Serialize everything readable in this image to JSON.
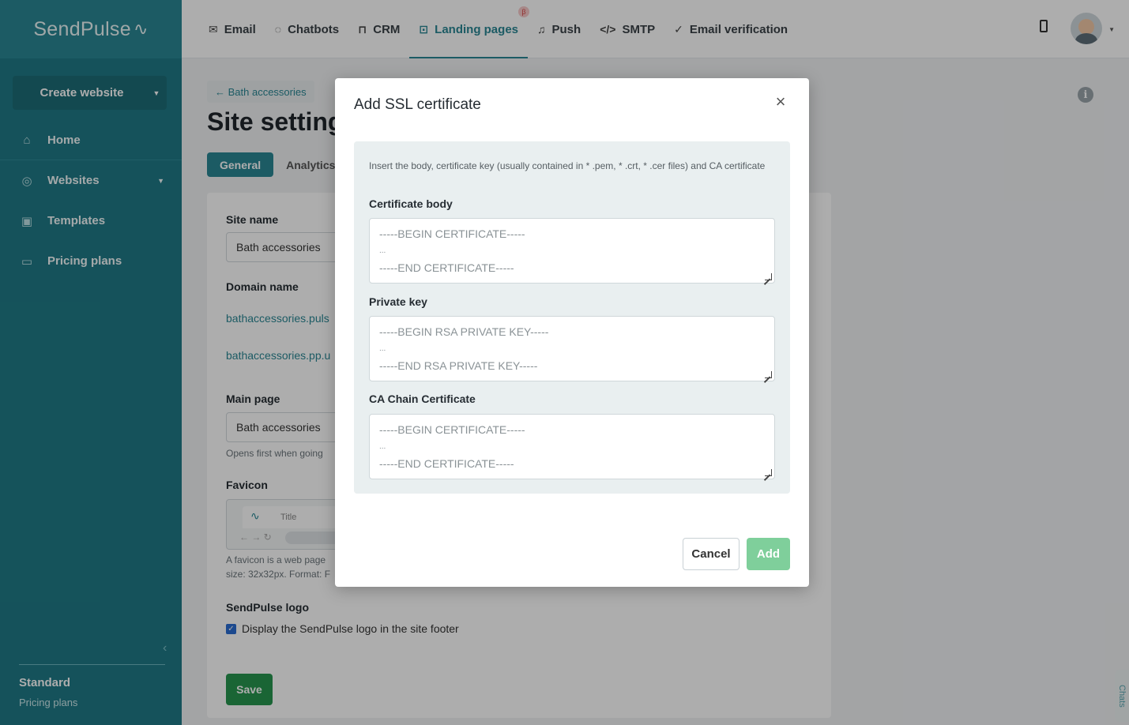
{
  "app": {
    "logo": "SendPulse",
    "logo_mark": "⁄∿"
  },
  "sidebar": {
    "create_button": "Create website",
    "items": [
      {
        "label": "Home",
        "icon": "home-icon"
      },
      {
        "label": "Websites",
        "icon": "globe-icon"
      },
      {
        "label": "Templates",
        "icon": "templates-icon"
      },
      {
        "label": "Pricing plans",
        "icon": "wallet-icon"
      }
    ],
    "plan_name": "Standard",
    "plan_link": "Pricing plans"
  },
  "topnav": {
    "tabs": [
      {
        "label": "Email",
        "icon": "✉"
      },
      {
        "label": "Chatbots",
        "icon": "◌"
      },
      {
        "label": "CRM",
        "icon": "⊓"
      },
      {
        "label": "Landing pages",
        "icon": "⊡",
        "badge": "β"
      },
      {
        "label": "Push",
        "icon": "🔔"
      },
      {
        "label": "SMTP",
        "icon": "</>"
      },
      {
        "label": "Email verification",
        "icon": "✓"
      }
    ],
    "active_tab": "Landing pages"
  },
  "page": {
    "back_link": "← Bath accessories",
    "title": "Site setting",
    "tabs": [
      "General",
      "Analytics"
    ],
    "site_name_label": "Site name",
    "site_name_value": "Bath accessories",
    "domain_label": "Domain name",
    "domain_1": "bathaccessories.puls",
    "domain_2": "bathaccessories.pp.u",
    "main_page_label": "Main page",
    "main_page_value": "Bath accessories",
    "main_page_hint": "Opens first when going",
    "favicon_label": "Favicon",
    "favicon_tab_title": "Title",
    "favicon_hint_1": "A favicon is a web page",
    "favicon_hint_2": "size: 32x32px. Format: F",
    "logo_label": "SendPulse logo",
    "logo_checkbox": "Display the SendPulse logo in the site footer",
    "save_button": "Save",
    "chats_tab": "Chats"
  },
  "modal": {
    "title": "Add SSL certificate",
    "intro": "Insert the body, certificate key (usually contained in * .pem, * .crt, * .cer files) and CA certificate",
    "fields": [
      {
        "label": "Certificate body",
        "ph_begin": "-----BEGIN CERTIFICATE-----",
        "ph_dots": "...",
        "ph_end": "-----END CERTIFICATE-----"
      },
      {
        "label": "Private key",
        "ph_begin": "-----BEGIN RSA PRIVATE KEY-----",
        "ph_dots": "...",
        "ph_end": "-----END RSA PRIVATE KEY-----"
      },
      {
        "label": "CA Chain Certificate",
        "ph_begin": "-----BEGIN CERTIFICATE-----",
        "ph_dots": "...",
        "ph_end": "-----END CERTIFICATE-----"
      }
    ],
    "cancel_button": "Cancel",
    "add_button": "Add"
  }
}
